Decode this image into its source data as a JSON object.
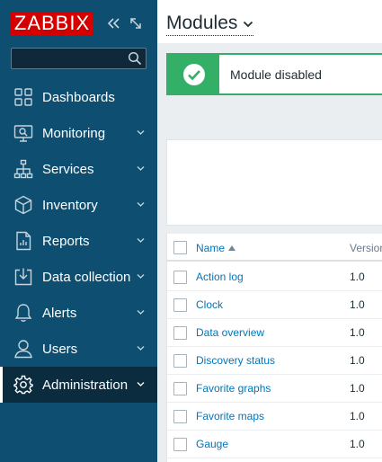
{
  "sidebar": {
    "logo": "ZABBIX",
    "search": {
      "value": "",
      "placeholder": ""
    },
    "items": [
      {
        "label": "Dashboards",
        "icon": "dashboards-icon",
        "has_submenu": false,
        "active": false
      },
      {
        "label": "Monitoring",
        "icon": "monitoring-icon",
        "has_submenu": true,
        "active": false
      },
      {
        "label": "Services",
        "icon": "services-icon",
        "has_submenu": true,
        "active": false
      },
      {
        "label": "Inventory",
        "icon": "inventory-icon",
        "has_submenu": true,
        "active": false
      },
      {
        "label": "Reports",
        "icon": "reports-icon",
        "has_submenu": true,
        "active": false
      },
      {
        "label": "Data collection",
        "icon": "data-collection-icon",
        "has_submenu": true,
        "active": false
      },
      {
        "label": "Alerts",
        "icon": "alerts-icon",
        "has_submenu": true,
        "active": false
      },
      {
        "label": "Users",
        "icon": "users-icon",
        "has_submenu": true,
        "active": false
      },
      {
        "label": "Administration",
        "icon": "administration-icon",
        "has_submenu": true,
        "active": true
      }
    ]
  },
  "header": {
    "title": "Modules"
  },
  "message": {
    "text": "Module disabled",
    "status_color": "#34af67"
  },
  "table": {
    "columns": {
      "name": "Name",
      "version": "Version"
    },
    "rows": [
      {
        "name": "Action log",
        "version": "1.0"
      },
      {
        "name": "Clock",
        "version": "1.0"
      },
      {
        "name": "Data overview",
        "version": "1.0"
      },
      {
        "name": "Discovery status",
        "version": "1.0"
      },
      {
        "name": "Favorite graphs",
        "version": "1.0"
      },
      {
        "name": "Favorite maps",
        "version": "1.0"
      },
      {
        "name": "Gauge",
        "version": "1.0"
      }
    ]
  },
  "colors": {
    "sidebar_bg": "#0e4f71",
    "logo_bg": "#d40000",
    "link": "#0275b8",
    "success": "#34af67"
  }
}
